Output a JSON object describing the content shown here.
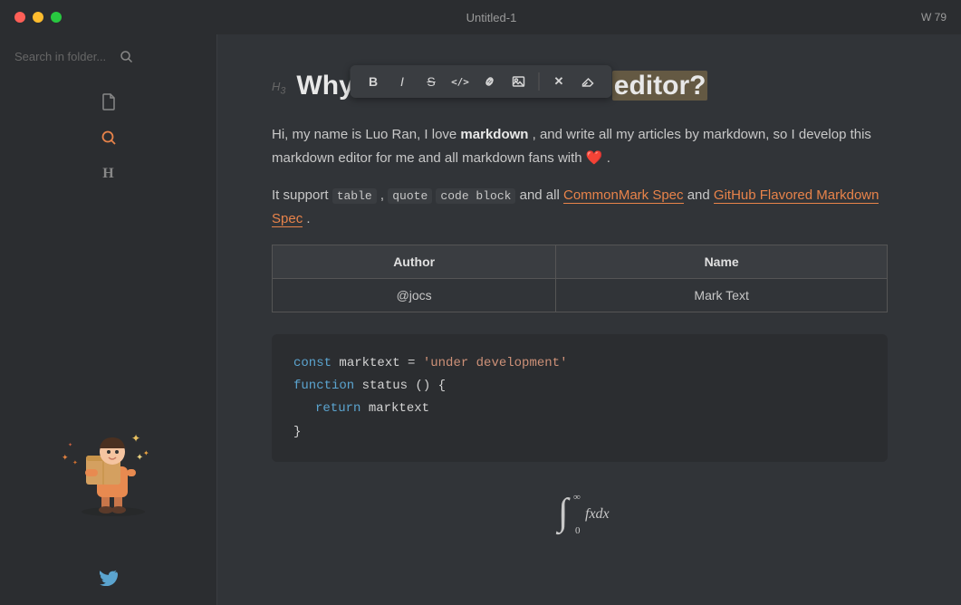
{
  "titlebar": {
    "title": "Untitled-1",
    "word_count": "W 79",
    "dots": [
      "red",
      "yellow",
      "green"
    ]
  },
  "toolbar": {
    "buttons": [
      {
        "id": "bold",
        "label": "B",
        "style": "bold"
      },
      {
        "id": "italic",
        "label": "I",
        "style": "italic"
      },
      {
        "id": "strikethrough",
        "label": "S̶",
        "unicode": "S̶"
      },
      {
        "id": "code",
        "label": "</>"
      },
      {
        "id": "link",
        "label": "🔗"
      },
      {
        "id": "image",
        "label": "🖼"
      },
      {
        "id": "clear",
        "label": "✕"
      },
      {
        "id": "erase",
        "label": "⌫"
      }
    ]
  },
  "sidebar": {
    "search_placeholder": "Search in folder...",
    "nav_items": [
      {
        "id": "file",
        "icon": "📄",
        "active": false
      },
      {
        "id": "search",
        "icon": "🔍",
        "active": true
      },
      {
        "id": "heading",
        "icon": "H",
        "active": false
      }
    ],
    "bottom": {
      "twitter_label": "Twitter"
    }
  },
  "content": {
    "heading_label": "H₃",
    "heading": "Why another markdown editor?",
    "heading_highlight_word": "editor?",
    "para1_start": "Hi, my name is Luo Ran, I love ",
    "para1_bold": "markdown",
    "para1_end": ", and write all my articles by markdown, so I develop this markdown editor for me and all markdown fans with",
    "heart": "❤️",
    "para2_start": "It support ",
    "para2_code1": "table",
    "para2_code2": "quote",
    "para2_code3": "code block",
    "para2_mid": " and all ",
    "para2_link1": "CommonMark Spec",
    "para2_link1_url": "#",
    "para2_and": " and ",
    "para2_link2": "GitHub Flavored Markdown Spec",
    "para2_link2_url": "#",
    "table": {
      "headers": [
        "Author",
        "Name"
      ],
      "rows": [
        [
          "@jocs",
          "Mark Text"
        ]
      ]
    },
    "code": {
      "line1_kw": "const",
      "line1_var": " marktext = ",
      "line1_str": "'under development'",
      "line2_kw": "function",
      "line2_fn": " status",
      "line2_rest": " () {",
      "line3_kw": "    return",
      "line3_var": " marktext",
      "line4": "}"
    },
    "math": "∫₀^∞ fxdx"
  }
}
